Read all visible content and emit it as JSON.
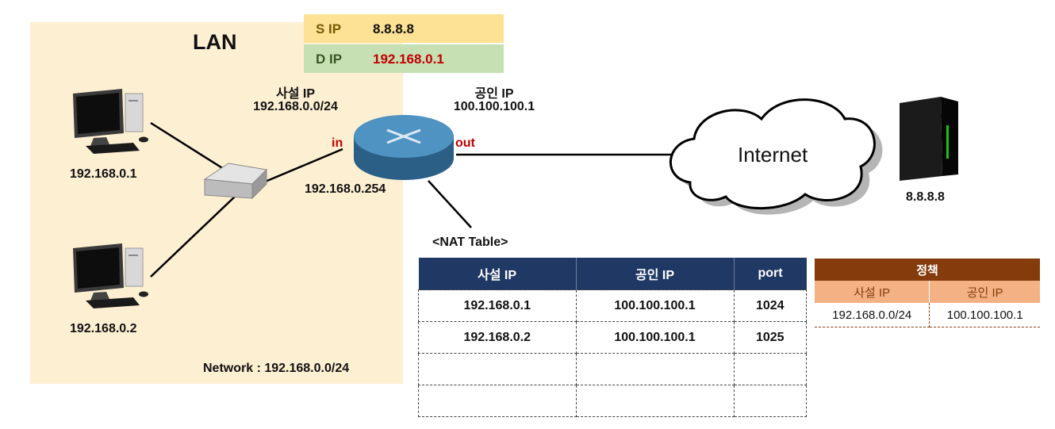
{
  "lan": {
    "title": "LAN",
    "network_label": "Network : 192.168.0.0/24",
    "hosts": [
      {
        "ip": "192.168.0.1"
      },
      {
        "ip": "192.168.0.2"
      }
    ]
  },
  "packet": {
    "s_ip_label": "S IP",
    "s_ip_value": "8.8.8.8",
    "d_ip_label": "D IP",
    "d_ip_value": "192.168.0.1",
    "colors": {
      "s_bg": "#fde295",
      "d_bg": "#c6e0b4",
      "d_value": "#c00000"
    }
  },
  "router": {
    "private_label": "사설 IP",
    "private_network": "192.168.0.0/24",
    "public_label": "공인 IP",
    "public_ip": "100.100.100.1",
    "in_label": "in",
    "out_label": "out",
    "inside_ip": "192.168.0.254"
  },
  "internet": {
    "label": "Internet"
  },
  "server": {
    "ip": "8.8.8.8"
  },
  "nat_table": {
    "title": "<NAT Table>",
    "headers": [
      "사설 IP",
      "공인 IP",
      "port"
    ],
    "rows": [
      [
        "192.168.0.1",
        "100.100.100.1",
        "1024"
      ],
      [
        "192.168.0.2",
        "100.100.100.1",
        "1025"
      ],
      [
        "",
        "",
        ""
      ],
      [
        "",
        "",
        ""
      ]
    ]
  },
  "policy": {
    "title": "정책",
    "headers": [
      "사설 IP",
      "공인 IP"
    ],
    "row": [
      "192.168.0.0/24",
      "100.100.100.1"
    ]
  }
}
